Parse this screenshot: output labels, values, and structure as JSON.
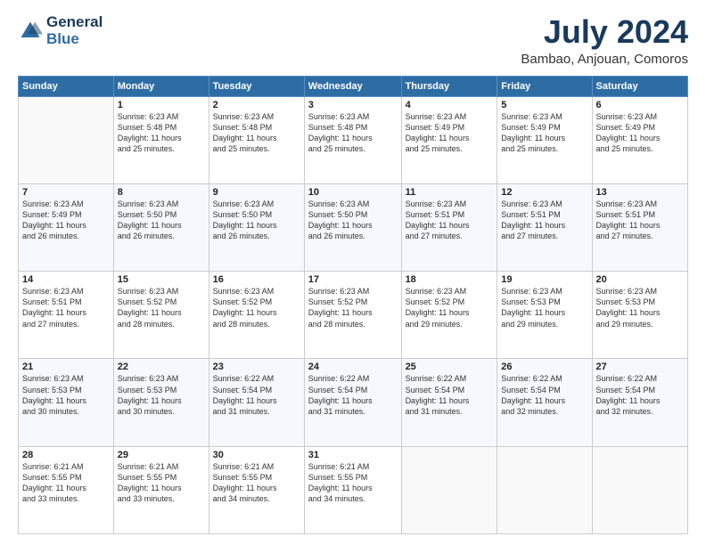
{
  "header": {
    "logo_line1": "General",
    "logo_line2": "Blue",
    "month": "July 2024",
    "location": "Bambao, Anjouan, Comoros"
  },
  "weekdays": [
    "Sunday",
    "Monday",
    "Tuesday",
    "Wednesday",
    "Thursday",
    "Friday",
    "Saturday"
  ],
  "weeks": [
    [
      {
        "day": "",
        "info": ""
      },
      {
        "day": "1",
        "info": "Sunrise: 6:23 AM\nSunset: 5:48 PM\nDaylight: 11 hours\nand 25 minutes."
      },
      {
        "day": "2",
        "info": "Sunrise: 6:23 AM\nSunset: 5:48 PM\nDaylight: 11 hours\nand 25 minutes."
      },
      {
        "day": "3",
        "info": "Sunrise: 6:23 AM\nSunset: 5:48 PM\nDaylight: 11 hours\nand 25 minutes."
      },
      {
        "day": "4",
        "info": "Sunrise: 6:23 AM\nSunset: 5:49 PM\nDaylight: 11 hours\nand 25 minutes."
      },
      {
        "day": "5",
        "info": "Sunrise: 6:23 AM\nSunset: 5:49 PM\nDaylight: 11 hours\nand 25 minutes."
      },
      {
        "day": "6",
        "info": "Sunrise: 6:23 AM\nSunset: 5:49 PM\nDaylight: 11 hours\nand 25 minutes."
      }
    ],
    [
      {
        "day": "7",
        "info": "Sunrise: 6:23 AM\nSunset: 5:49 PM\nDaylight: 11 hours\nand 26 minutes."
      },
      {
        "day": "8",
        "info": "Sunrise: 6:23 AM\nSunset: 5:50 PM\nDaylight: 11 hours\nand 26 minutes."
      },
      {
        "day": "9",
        "info": "Sunrise: 6:23 AM\nSunset: 5:50 PM\nDaylight: 11 hours\nand 26 minutes."
      },
      {
        "day": "10",
        "info": "Sunrise: 6:23 AM\nSunset: 5:50 PM\nDaylight: 11 hours\nand 26 minutes."
      },
      {
        "day": "11",
        "info": "Sunrise: 6:23 AM\nSunset: 5:51 PM\nDaylight: 11 hours\nand 27 minutes."
      },
      {
        "day": "12",
        "info": "Sunrise: 6:23 AM\nSunset: 5:51 PM\nDaylight: 11 hours\nand 27 minutes."
      },
      {
        "day": "13",
        "info": "Sunrise: 6:23 AM\nSunset: 5:51 PM\nDaylight: 11 hours\nand 27 minutes."
      }
    ],
    [
      {
        "day": "14",
        "info": "Sunrise: 6:23 AM\nSunset: 5:51 PM\nDaylight: 11 hours\nand 27 minutes."
      },
      {
        "day": "15",
        "info": "Sunrise: 6:23 AM\nSunset: 5:52 PM\nDaylight: 11 hours\nand 28 minutes."
      },
      {
        "day": "16",
        "info": "Sunrise: 6:23 AM\nSunset: 5:52 PM\nDaylight: 11 hours\nand 28 minutes."
      },
      {
        "day": "17",
        "info": "Sunrise: 6:23 AM\nSunset: 5:52 PM\nDaylight: 11 hours\nand 28 minutes."
      },
      {
        "day": "18",
        "info": "Sunrise: 6:23 AM\nSunset: 5:52 PM\nDaylight: 11 hours\nand 29 minutes."
      },
      {
        "day": "19",
        "info": "Sunrise: 6:23 AM\nSunset: 5:53 PM\nDaylight: 11 hours\nand 29 minutes."
      },
      {
        "day": "20",
        "info": "Sunrise: 6:23 AM\nSunset: 5:53 PM\nDaylight: 11 hours\nand 29 minutes."
      }
    ],
    [
      {
        "day": "21",
        "info": "Sunrise: 6:23 AM\nSunset: 5:53 PM\nDaylight: 11 hours\nand 30 minutes."
      },
      {
        "day": "22",
        "info": "Sunrise: 6:23 AM\nSunset: 5:53 PM\nDaylight: 11 hours\nand 30 minutes."
      },
      {
        "day": "23",
        "info": "Sunrise: 6:22 AM\nSunset: 5:54 PM\nDaylight: 11 hours\nand 31 minutes."
      },
      {
        "day": "24",
        "info": "Sunrise: 6:22 AM\nSunset: 5:54 PM\nDaylight: 11 hours\nand 31 minutes."
      },
      {
        "day": "25",
        "info": "Sunrise: 6:22 AM\nSunset: 5:54 PM\nDaylight: 11 hours\nand 31 minutes."
      },
      {
        "day": "26",
        "info": "Sunrise: 6:22 AM\nSunset: 5:54 PM\nDaylight: 11 hours\nand 32 minutes."
      },
      {
        "day": "27",
        "info": "Sunrise: 6:22 AM\nSunset: 5:54 PM\nDaylight: 11 hours\nand 32 minutes."
      }
    ],
    [
      {
        "day": "28",
        "info": "Sunrise: 6:21 AM\nSunset: 5:55 PM\nDaylight: 11 hours\nand 33 minutes."
      },
      {
        "day": "29",
        "info": "Sunrise: 6:21 AM\nSunset: 5:55 PM\nDaylight: 11 hours\nand 33 minutes."
      },
      {
        "day": "30",
        "info": "Sunrise: 6:21 AM\nSunset: 5:55 PM\nDaylight: 11 hours\nand 34 minutes."
      },
      {
        "day": "31",
        "info": "Sunrise: 6:21 AM\nSunset: 5:55 PM\nDaylight: 11 hours\nand 34 minutes."
      },
      {
        "day": "",
        "info": ""
      },
      {
        "day": "",
        "info": ""
      },
      {
        "day": "",
        "info": ""
      }
    ]
  ]
}
